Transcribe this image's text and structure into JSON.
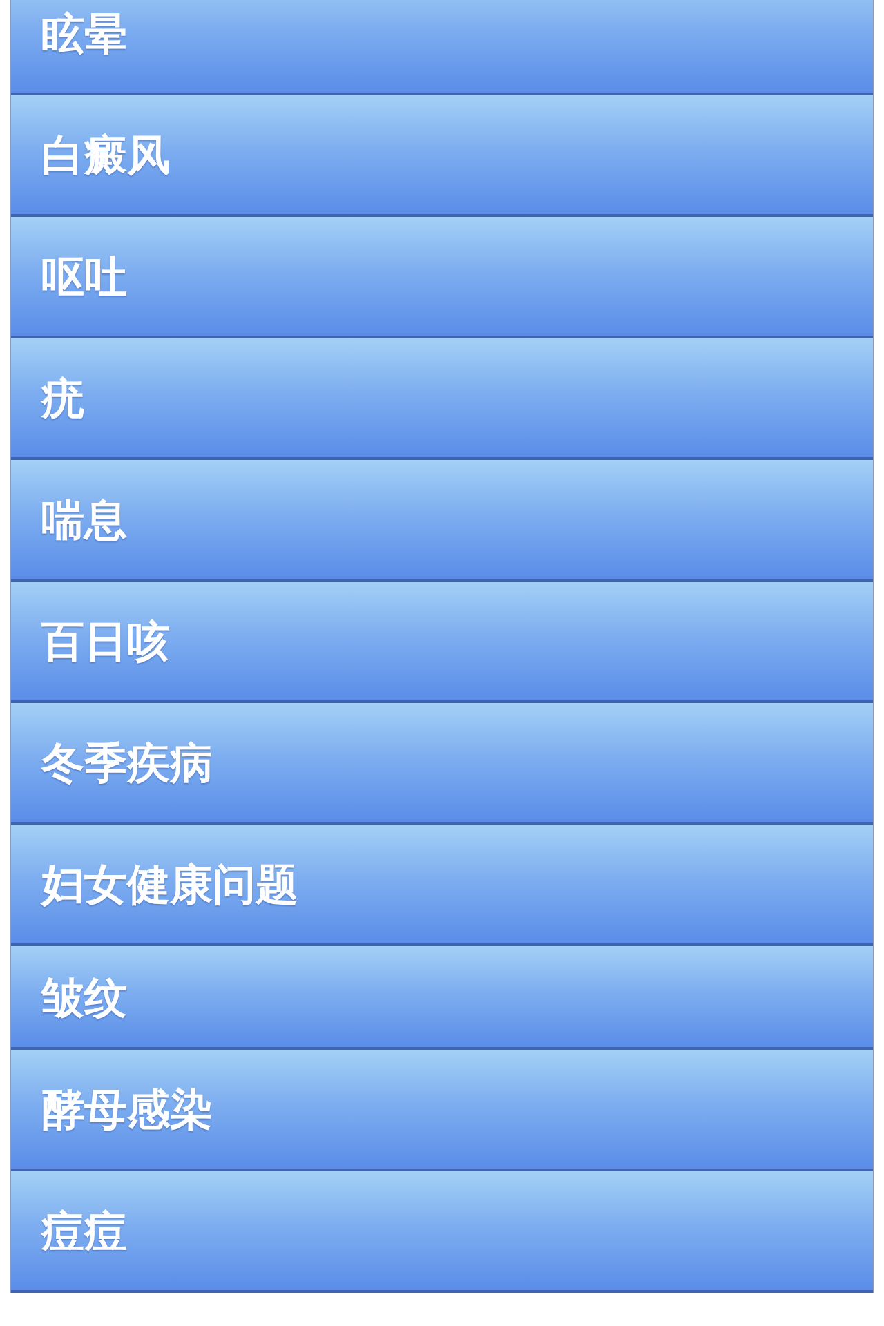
{
  "items": [
    {
      "label": "眩晕"
    },
    {
      "label": "白癜风"
    },
    {
      "label": "呕吐"
    },
    {
      "label": "疣"
    },
    {
      "label": "喘息"
    },
    {
      "label": "百日咳"
    },
    {
      "label": "冬季疾病"
    },
    {
      "label": "妇女健康问题"
    },
    {
      "label": "皱纹"
    },
    {
      "label": "酵母感染"
    },
    {
      "label": "痘痘"
    }
  ]
}
